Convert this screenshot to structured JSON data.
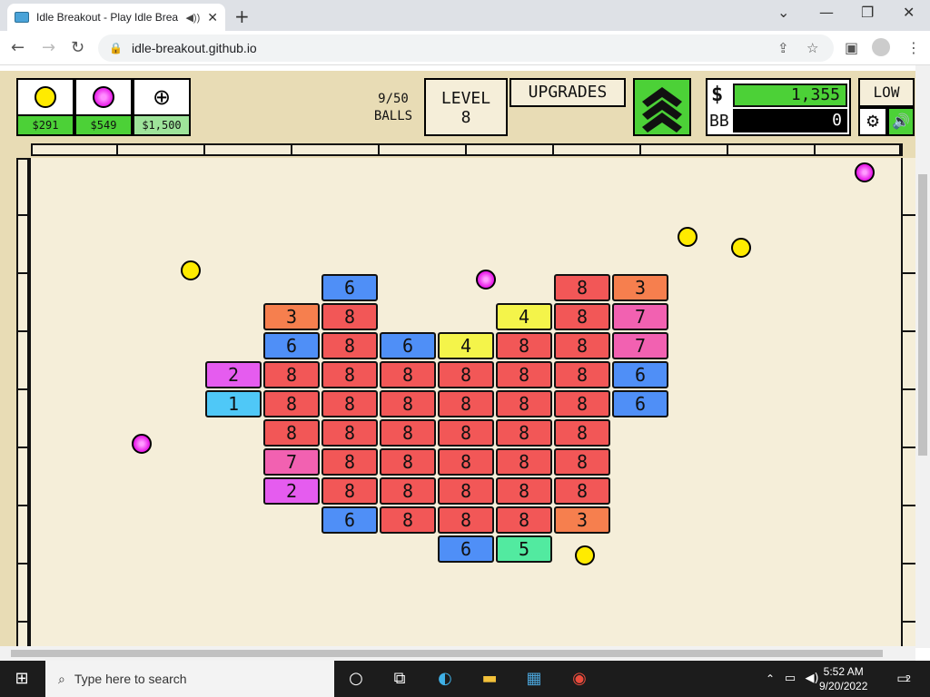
{
  "browser": {
    "tab_title": "Idle Breakout - Play Idle Brea",
    "url": "idle-breakout.github.io"
  },
  "shop": [
    {
      "price": "$291",
      "ball_color": "#ffeb00"
    },
    {
      "price": "$549",
      "ball_color": "#e91ee9"
    },
    {
      "price": "$1,500",
      "icon": "plus-circle-icon"
    }
  ],
  "hud": {
    "balls_count": "9/50",
    "balls_label": "BALLS",
    "level_label": "LEVEL",
    "level_value": "8",
    "upgrades_label": "UPGRADES",
    "money_symbol": "$",
    "money_value": "1,355",
    "bb_label": "BB",
    "bb_value": "0",
    "quality_label": "LOW"
  },
  "bricks": [
    {
      "col": 2,
      "row": 0,
      "value": "6",
      "color": "#4f8ff7"
    },
    {
      "col": 6,
      "row": 0,
      "value": "8",
      "color": "#f25757"
    },
    {
      "col": 7,
      "row": 0,
      "value": "3",
      "color": "#f67f4e"
    },
    {
      "col": 1,
      "row": 1,
      "value": "3",
      "color": "#f67f4e"
    },
    {
      "col": 2,
      "row": 1,
      "value": "8",
      "color": "#f25757"
    },
    {
      "col": 5,
      "row": 1,
      "value": "4",
      "color": "#f4f44a"
    },
    {
      "col": 6,
      "row": 1,
      "value": "8",
      "color": "#f25757"
    },
    {
      "col": 7,
      "row": 1,
      "value": "7",
      "color": "#f261b1"
    },
    {
      "col": 1,
      "row": 2,
      "value": "6",
      "color": "#4f8ff7"
    },
    {
      "col": 2,
      "row": 2,
      "value": "8",
      "color": "#f25757"
    },
    {
      "col": 3,
      "row": 2,
      "value": "6",
      "color": "#4f8ff7"
    },
    {
      "col": 4,
      "row": 2,
      "value": "4",
      "color": "#f4f44a"
    },
    {
      "col": 5,
      "row": 2,
      "value": "8",
      "color": "#f25757"
    },
    {
      "col": 6,
      "row": 2,
      "value": "8",
      "color": "#f25757"
    },
    {
      "col": 7,
      "row": 2,
      "value": "7",
      "color": "#f261b1"
    },
    {
      "col": 0,
      "row": 3,
      "value": "2",
      "color": "#e55cef"
    },
    {
      "col": 1,
      "row": 3,
      "value": "8",
      "color": "#f25757"
    },
    {
      "col": 2,
      "row": 3,
      "value": "8",
      "color": "#f25757"
    },
    {
      "col": 3,
      "row": 3,
      "value": "8",
      "color": "#f25757"
    },
    {
      "col": 4,
      "row": 3,
      "value": "8",
      "color": "#f25757"
    },
    {
      "col": 5,
      "row": 3,
      "value": "8",
      "color": "#f25757"
    },
    {
      "col": 6,
      "row": 3,
      "value": "8",
      "color": "#f25757"
    },
    {
      "col": 7,
      "row": 3,
      "value": "6",
      "color": "#4f8ff7"
    },
    {
      "col": 0,
      "row": 4,
      "value": "1",
      "color": "#4fc8f7"
    },
    {
      "col": 1,
      "row": 4,
      "value": "8",
      "color": "#f25757"
    },
    {
      "col": 2,
      "row": 4,
      "value": "8",
      "color": "#f25757"
    },
    {
      "col": 3,
      "row": 4,
      "value": "8",
      "color": "#f25757"
    },
    {
      "col": 4,
      "row": 4,
      "value": "8",
      "color": "#f25757"
    },
    {
      "col": 5,
      "row": 4,
      "value": "8",
      "color": "#f25757"
    },
    {
      "col": 6,
      "row": 4,
      "value": "8",
      "color": "#f25757"
    },
    {
      "col": 7,
      "row": 4,
      "value": "6",
      "color": "#4f8ff7"
    },
    {
      "col": 1,
      "row": 5,
      "value": "8",
      "color": "#f25757"
    },
    {
      "col": 2,
      "row": 5,
      "value": "8",
      "color": "#f25757"
    },
    {
      "col": 3,
      "row": 5,
      "value": "8",
      "color": "#f25757"
    },
    {
      "col": 4,
      "row": 5,
      "value": "8",
      "color": "#f25757"
    },
    {
      "col": 5,
      "row": 5,
      "value": "8",
      "color": "#f25757"
    },
    {
      "col": 6,
      "row": 5,
      "value": "8",
      "color": "#f25757"
    },
    {
      "col": 1,
      "row": 6,
      "value": "7",
      "color": "#f261b1"
    },
    {
      "col": 2,
      "row": 6,
      "value": "8",
      "color": "#f25757"
    },
    {
      "col": 3,
      "row": 6,
      "value": "8",
      "color": "#f25757"
    },
    {
      "col": 4,
      "row": 6,
      "value": "8",
      "color": "#f25757"
    },
    {
      "col": 5,
      "row": 6,
      "value": "8",
      "color": "#f25757"
    },
    {
      "col": 6,
      "row": 6,
      "value": "8",
      "color": "#f25757"
    },
    {
      "col": 1,
      "row": 7,
      "value": "2",
      "color": "#e55cef"
    },
    {
      "col": 2,
      "row": 7,
      "value": "8",
      "color": "#f25757"
    },
    {
      "col": 3,
      "row": 7,
      "value": "8",
      "color": "#f25757"
    },
    {
      "col": 4,
      "row": 7,
      "value": "8",
      "color": "#f25757"
    },
    {
      "col": 5,
      "row": 7,
      "value": "8",
      "color": "#f25757"
    },
    {
      "col": 6,
      "row": 7,
      "value": "8",
      "color": "#f25757"
    },
    {
      "col": 2,
      "row": 8,
      "value": "6",
      "color": "#4f8ff7"
    },
    {
      "col": 3,
      "row": 8,
      "value": "8",
      "color": "#f25757"
    },
    {
      "col": 4,
      "row": 8,
      "value": "8",
      "color": "#f25757"
    },
    {
      "col": 5,
      "row": 8,
      "value": "8",
      "color": "#f25757"
    },
    {
      "col": 6,
      "row": 8,
      "value": "3",
      "color": "#f67f4e"
    },
    {
      "col": 4,
      "row": 9,
      "value": "6",
      "color": "#4f8ff7"
    },
    {
      "col": 5,
      "row": 9,
      "value": "5",
      "color": "#52eaa0"
    }
  ],
  "ball_colors": {
    "basic": "#ffeb00",
    "plasma": "#e91ee9"
  },
  "taskbar": {
    "search_placeholder": "Type here to search",
    "time": "5:52 AM",
    "date": "9/20/2022",
    "notifications": "2"
  }
}
